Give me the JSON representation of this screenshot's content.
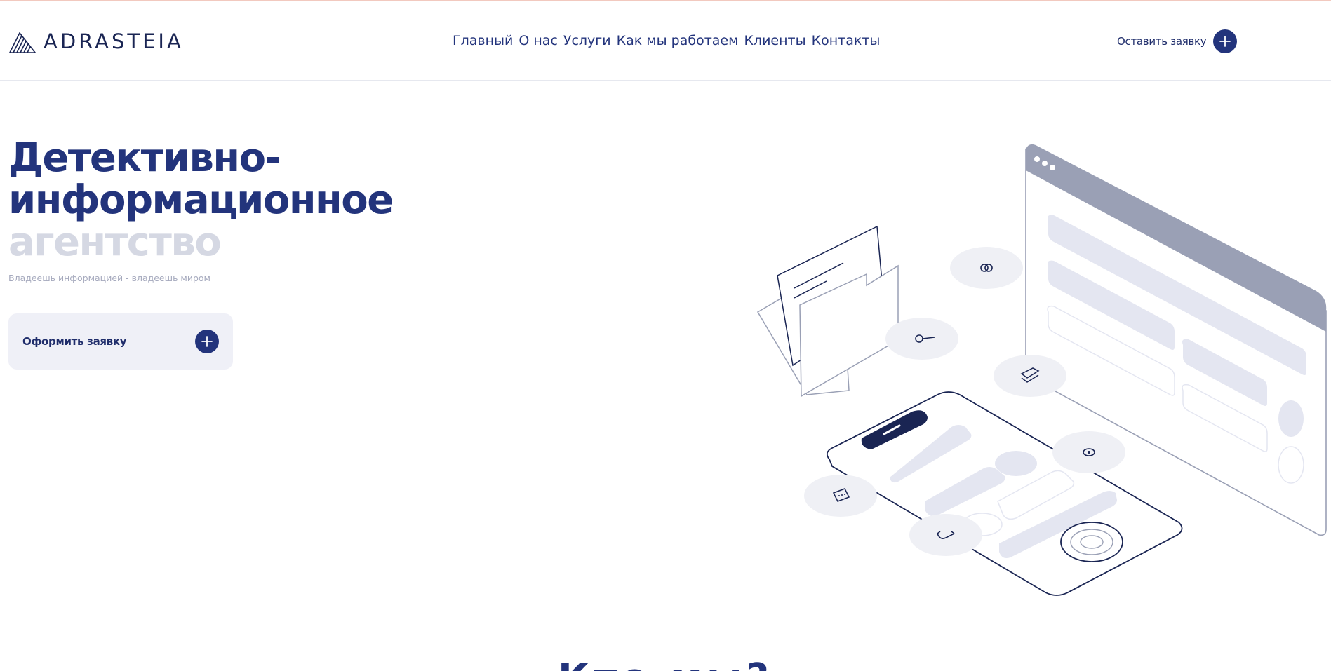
{
  "brand": {
    "name": "ADRASTEIA",
    "logo_icon": "diagonal-lines-triangle-logo",
    "color": "#23347c"
  },
  "nav": {
    "items": [
      {
        "label": "Главный"
      },
      {
        "label": "О нас"
      },
      {
        "label": "Услуги"
      },
      {
        "label": "Как мы работаем"
      },
      {
        "label": "Клиенты"
      },
      {
        "label": "Контакты"
      }
    ]
  },
  "header": {
    "cta_label": "Оставить заявку",
    "cta_icon": "plus-icon"
  },
  "hero": {
    "title_line1": "Детективно-",
    "title_line2": "информационное",
    "title_line3": "агентство",
    "tagline": "Владеешь информацией - владеешь миром",
    "button_label": "Оформить заявку",
    "button_icon": "plus-icon",
    "illustration": "isometric-browser-phone-folder-illustration"
  },
  "next_section": {
    "heading": "Кто мы?"
  },
  "colors": {
    "accent": "#23347c",
    "muted_text": "#a5a9bd",
    "light_title": "#d5d8e3",
    "button_bg": "#eff0f7",
    "top_line": "#f2c9bf"
  }
}
